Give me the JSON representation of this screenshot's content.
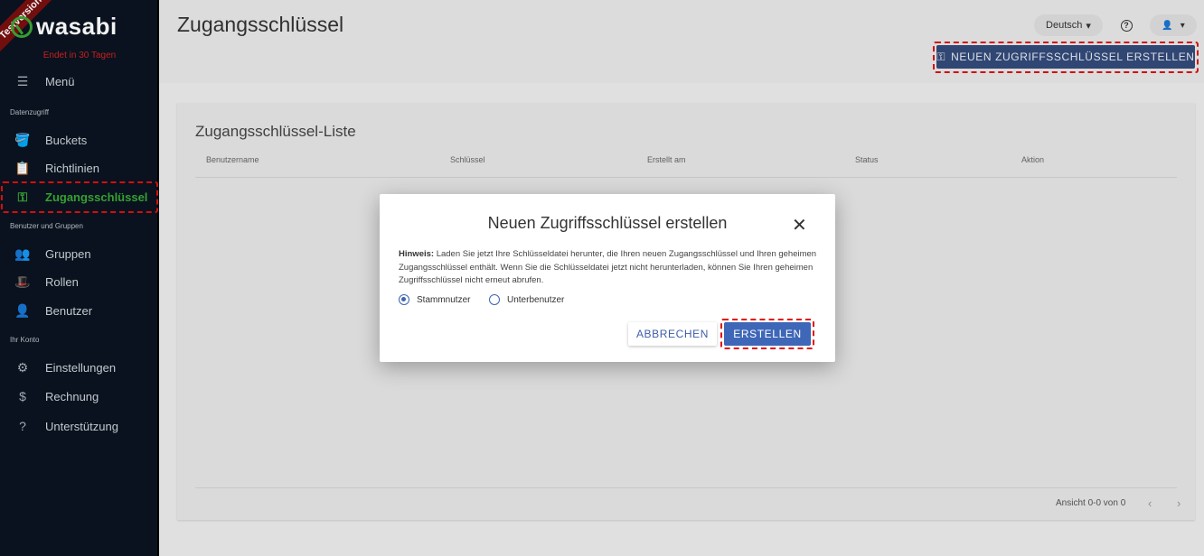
{
  "sidebar": {
    "ribbon": "Testversion",
    "logo": "wasabi",
    "trial_notice": "Endet in 30 Tagen",
    "menu_label": "Menü",
    "sections": {
      "data_access": "Datenzugriff",
      "users_groups": "Benutzer und Gruppen",
      "account": "Ihr Konto"
    },
    "items": {
      "buckets": "Buckets",
      "policies": "Richtlinien",
      "access_keys": "Zugangsschlüssel",
      "groups": "Gruppen",
      "roles": "Rollen",
      "users": "Benutzer",
      "settings": "Einstellungen",
      "billing": "Rechnung",
      "support": "Unterstützung"
    }
  },
  "header": {
    "title": "Zugangsschlüssel",
    "language": "Deutsch",
    "new_key_button": "NEUEN ZUGRIFFSSCHLÜSSEL ERSTELLEN"
  },
  "list": {
    "title": "Zugangsschlüssel-Liste",
    "columns": [
      "Benutzername",
      "Schlüssel",
      "Erstellt am",
      "Status",
      "Aktion"
    ],
    "pagination": "Ansicht 0-0 von 0"
  },
  "dialog": {
    "title": "Neuen Zugriffsschlüssel erstellen",
    "note_label": "Hinweis:",
    "note_text": "Laden Sie jetzt Ihre Schlüsseldatei herunter, die Ihren neuen Zugangsschlüssel und Ihren geheimen Zugangsschlüssel enthält. Wenn Sie die Schlüsseldatei jetzt nicht herunterladen, können Sie Ihren geheimen Zugriffsschlüssel nicht erneut abrufen.",
    "options": [
      "Stammnutzer",
      "Unterbenutzer"
    ],
    "selected_option": "Stammnutzer",
    "cancel_label": "ABBRECHEN",
    "create_label": "ERSTELLEN"
  },
  "colors": {
    "sidebar_bg": "#0a1320",
    "active_green": "#39a935",
    "primary_blue": "#3e67b8",
    "highlight_red": "#e01010"
  }
}
